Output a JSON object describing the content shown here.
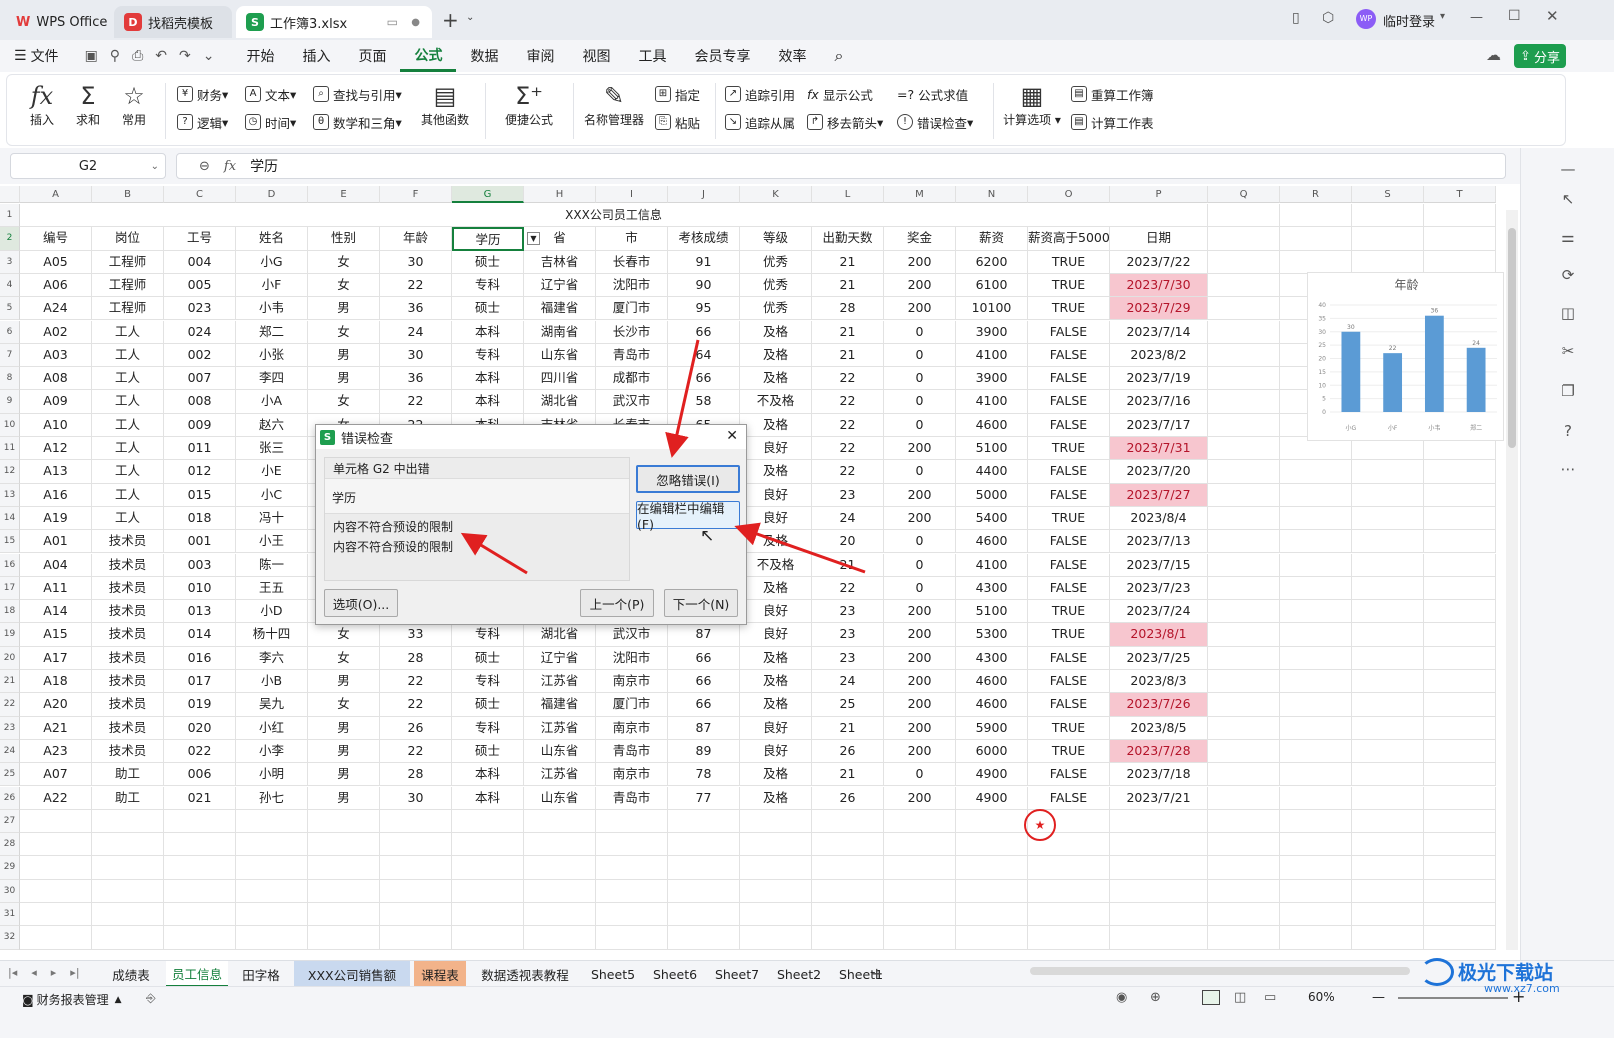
{
  "titlebar": {
    "tabs": [
      {
        "label": "WPS Office",
        "logo": "W",
        "color": "#e23b3b"
      },
      {
        "label": "找稻壳模板",
        "logo": "D",
        "color": "#e23b3b"
      },
      {
        "label": "工作簿3.xlsx",
        "logo": "S",
        "color": "#1e9e4f"
      }
    ],
    "login_label": "临时登录",
    "avatar_label": "WP"
  },
  "menubar": {
    "file_label": "文件",
    "items": [
      "开始",
      "插入",
      "页面",
      "公式",
      "数据",
      "审阅",
      "视图",
      "工具",
      "会员专享",
      "效率"
    ],
    "active": "公式",
    "share_label": "分享"
  },
  "ribbon": {
    "insert": "插入",
    "sum": "求和",
    "common": "常用",
    "finance": "财务",
    "text": "文本",
    "lookup": "查找与引用",
    "other_func": "其他函数",
    "logic": "逻辑",
    "time": "时间",
    "math": "数学和三角",
    "quick_formula": "便捷公式",
    "name_mgr": "名称管理器",
    "specify": "指定",
    "paste": "粘贴",
    "trace_prec": "追踪引用",
    "show_formula": "显示公式",
    "eval_formula": "公式求值",
    "trace_dep": "追踪从属",
    "remove_arrows": "移去箭头",
    "error_check": "错误检查",
    "calc_options": "计算选项",
    "recalc_book": "重算工作簿",
    "calc_sheet": "计算工作表"
  },
  "formula_bar": {
    "name_box": "G2",
    "content": "学历"
  },
  "columns": [
    "A",
    "B",
    "C",
    "D",
    "E",
    "F",
    "G",
    "H",
    "I",
    "J",
    "K",
    "L",
    "M",
    "N",
    "O",
    "P",
    "Q",
    "R",
    "S",
    "T"
  ],
  "title_row": "XXX公司员工信息",
  "headers": [
    "编号",
    "岗位",
    "工号",
    "姓名",
    "性别",
    "年龄",
    "学历",
    "省",
    "市",
    "考核成绩",
    "等级",
    "出勤天数",
    "奖金",
    "薪资",
    "薪资高于5000",
    "日期"
  ],
  "rows": [
    [
      "A05",
      "工程师",
      "004",
      "小G",
      "女",
      "30",
      "硕士",
      "吉林省",
      "长春市",
      "91",
      "优秀",
      "21",
      "200",
      "6200",
      "TRUE",
      "2023/7/22"
    ],
    [
      "A06",
      "工程师",
      "005",
      "小F",
      "女",
      "22",
      "专科",
      "辽宁省",
      "沈阳市",
      "90",
      "优秀",
      "21",
      "200",
      "6100",
      "TRUE",
      "2023/7/30"
    ],
    [
      "A24",
      "工程师",
      "023",
      "小韦",
      "男",
      "36",
      "硕士",
      "福建省",
      "厦门市",
      "95",
      "优秀",
      "28",
      "200",
      "10100",
      "TRUE",
      "2023/7/29"
    ],
    [
      "A02",
      "工人",
      "024",
      "郑二",
      "女",
      "24",
      "本科",
      "湖南省",
      "长沙市",
      "66",
      "及格",
      "21",
      "0",
      "3900",
      "FALSE",
      "2023/7/14"
    ],
    [
      "A03",
      "工人",
      "002",
      "小张",
      "男",
      "30",
      "专科",
      "山东省",
      "青岛市",
      "64",
      "及格",
      "21",
      "0",
      "4100",
      "FALSE",
      "2023/8/2"
    ],
    [
      "A08",
      "工人",
      "007",
      "李四",
      "男",
      "36",
      "本科",
      "四川省",
      "成都市",
      "66",
      "及格",
      "22",
      "0",
      "3900",
      "FALSE",
      "2023/7/19"
    ],
    [
      "A09",
      "工人",
      "008",
      "小A",
      "女",
      "22",
      "本科",
      "湖北省",
      "武汉市",
      "58",
      "不及格",
      "22",
      "0",
      "4100",
      "FALSE",
      "2023/7/16"
    ],
    [
      "A10",
      "工人",
      "009",
      "赵六",
      "女",
      "22",
      "本科",
      "吉林省",
      "长春市",
      "65",
      "及格",
      "22",
      "0",
      "4600",
      "FALSE",
      "2023/7/17"
    ],
    [
      "A12",
      "工人",
      "011",
      "张三",
      "",
      "",
      "",
      "",
      "",
      "",
      "良好",
      "22",
      "200",
      "5100",
      "TRUE",
      "2023/7/31"
    ],
    [
      "A13",
      "工人",
      "012",
      "小E",
      "",
      "",
      "",
      "",
      "",
      "",
      "及格",
      "22",
      "0",
      "4400",
      "FALSE",
      "2023/7/20"
    ],
    [
      "A16",
      "工人",
      "015",
      "小C",
      "",
      "",
      "",
      "",
      "",
      "",
      "良好",
      "23",
      "200",
      "5000",
      "FALSE",
      "2023/7/27"
    ],
    [
      "A19",
      "工人",
      "018",
      "冯十",
      "",
      "",
      "",
      "",
      "",
      "",
      "良好",
      "24",
      "200",
      "5400",
      "TRUE",
      "2023/8/4"
    ],
    [
      "A01",
      "技术员",
      "001",
      "小王",
      "",
      "",
      "",
      "",
      "",
      "",
      "及格",
      "20",
      "0",
      "4600",
      "FALSE",
      "2023/7/13"
    ],
    [
      "A04",
      "技术员",
      "003",
      "陈一",
      "",
      "",
      "",
      "",
      "",
      "",
      "不及格",
      "21",
      "0",
      "4100",
      "FALSE",
      "2023/7/15"
    ],
    [
      "A11",
      "技术员",
      "010",
      "王五",
      "",
      "",
      "",
      "",
      "",
      "",
      "及格",
      "22",
      "0",
      "4300",
      "FALSE",
      "2023/7/23"
    ],
    [
      "A14",
      "技术员",
      "013",
      "小D",
      "",
      "",
      "",
      "",
      "",
      "",
      "良好",
      "23",
      "200",
      "5100",
      "TRUE",
      "2023/7/24"
    ],
    [
      "A15",
      "技术员",
      "014",
      "杨十四",
      "女",
      "33",
      "专科",
      "湖北省",
      "武汉市",
      "87",
      "良好",
      "23",
      "200",
      "5300",
      "TRUE",
      "2023/8/1"
    ],
    [
      "A17",
      "技术员",
      "016",
      "李六",
      "女",
      "28",
      "硕士",
      "辽宁省",
      "沈阳市",
      "66",
      "及格",
      "23",
      "200",
      "4300",
      "FALSE",
      "2023/7/25"
    ],
    [
      "A18",
      "技术员",
      "017",
      "小B",
      "男",
      "22",
      "专科",
      "江苏省",
      "南京市",
      "66",
      "及格",
      "24",
      "200",
      "4600",
      "FALSE",
      "2023/8/3"
    ],
    [
      "A20",
      "技术员",
      "019",
      "吴九",
      "女",
      "22",
      "硕士",
      "福建省",
      "厦门市",
      "66",
      "及格",
      "25",
      "200",
      "4600",
      "FALSE",
      "2023/7/26"
    ],
    [
      "A21",
      "技术员",
      "020",
      "小红",
      "男",
      "26",
      "专科",
      "江苏省",
      "南京市",
      "87",
      "良好",
      "21",
      "200",
      "5900",
      "TRUE",
      "2023/8/5"
    ],
    [
      "A23",
      "技术员",
      "022",
      "小李",
      "男",
      "22",
      "硕士",
      "山东省",
      "青岛市",
      "89",
      "良好",
      "26",
      "200",
      "6000",
      "TRUE",
      "2023/7/28"
    ],
    [
      "A07",
      "助工",
      "006",
      "小明",
      "男",
      "28",
      "本科",
      "江苏省",
      "南京市",
      "78",
      "及格",
      "21",
      "0",
      "4900",
      "FALSE",
      "2023/7/18"
    ],
    [
      "A22",
      "助工",
      "021",
      "孙七",
      "男",
      "30",
      "本科",
      "山东省",
      "青岛市",
      "77",
      "及格",
      "26",
      "200",
      "4900",
      "FALSE",
      "2023/7/21"
    ]
  ],
  "highlight_dates": [
    "2023/7/30",
    "2023/7/29",
    "2023/7/31",
    "2023/7/27",
    "2023/8/1",
    "2023/7/26",
    "2023/7/28"
  ],
  "colors": {
    "accent": "#15803d",
    "highlight_bg": "#f7c6cf",
    "highlight_text": "#b4142a",
    "bar": "#5b9bd5",
    "arrow": "#e02020"
  },
  "chart_data": {
    "type": "bar",
    "title": "年龄",
    "categories": [
      "小G",
      "小F",
      "小韦",
      "郑二"
    ],
    "values": [
      30,
      22,
      36,
      24
    ],
    "ylim": [
      0,
      40
    ],
    "yticks": [
      0,
      5,
      10,
      15,
      20,
      25,
      30,
      35,
      40
    ]
  },
  "dialog": {
    "title": "错误检查",
    "cell_error": "单元格 G2 中出错",
    "cell_value": "学历",
    "reason_title": "内容不符合预设的限制",
    "reason_text": "内容不符合预设的限制",
    "ignore": "忽略错误(I)",
    "edit_in_bar": "在编辑栏中编辑(F)",
    "options": "选项(O)...",
    "prev": "上一个(P)",
    "next": "下一个(N)"
  },
  "sheet_tabs": [
    "成绩表",
    "员工信息",
    "田字格",
    "XXX公司销售额",
    "课程表",
    "数据透视表教程",
    "Sheet5",
    "Sheet6",
    "Sheet7",
    "Sheet2",
    "Sheet1"
  ],
  "sheet_tab_active": "员工信息",
  "status": {
    "label": "财务报表管理",
    "zoom": "60%"
  },
  "watermark": "极光下载站",
  "watermark_url": "www.xz7.com"
}
